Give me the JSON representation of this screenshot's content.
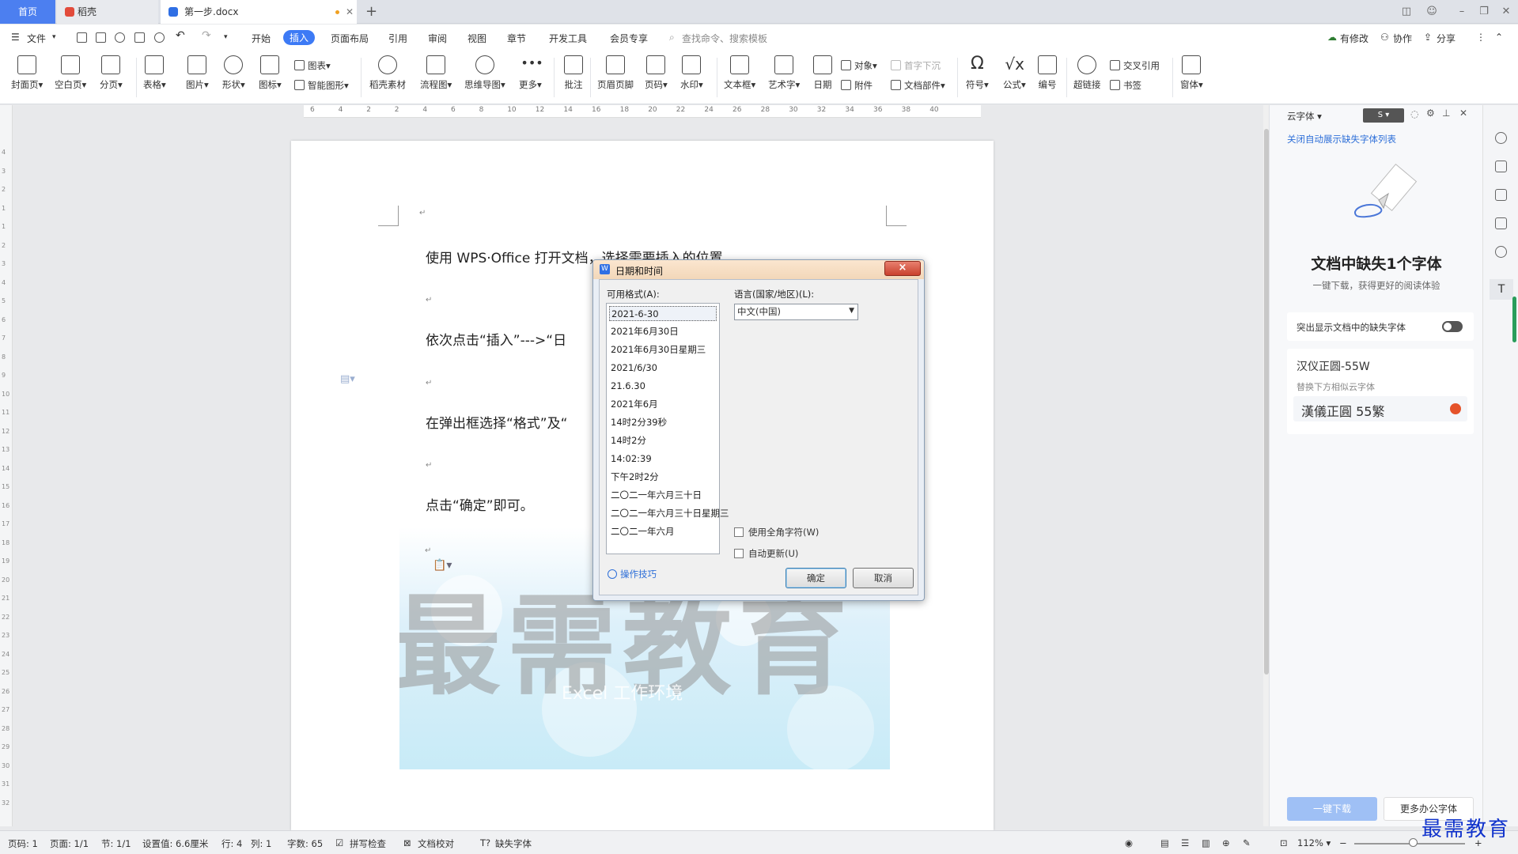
{
  "tabs": {
    "home": "首页",
    "daoke": "稻壳",
    "doc": "第一步.docx"
  },
  "menu": {
    "file": "文件",
    "items": [
      "开始",
      "插入",
      "页面布局",
      "引用",
      "审阅",
      "视图",
      "章节",
      "开发工具",
      "会员专享"
    ],
    "search": "查找命令、搜索模板",
    "right": [
      "有修改",
      "协作",
      "分享"
    ]
  },
  "ribbon": {
    "big": [
      "封面页",
      "空白页",
      "分页",
      "表格",
      "图片",
      "形状",
      "图标",
      "稻壳素材",
      "流程图",
      "思维导图",
      "更多",
      "批注",
      "页眉页脚",
      "页码",
      "水印",
      "文本框",
      "艺术字",
      "日期",
      "符号",
      "公式",
      "编号",
      "超链接",
      "窗体"
    ],
    "small": {
      "chart": "图表",
      "smart": "智能图形",
      "object": "对象",
      "dropcap": "首字下沉",
      "attach": "附件",
      "docpart": "文档部件",
      "crossref": "交叉引用",
      "bookmark": "书签"
    }
  },
  "ruler_numbers": [
    "6",
    "4",
    "2",
    "2",
    "4",
    "6",
    "8",
    "10",
    "12",
    "14",
    "16",
    "18",
    "20",
    "22",
    "24",
    "26",
    "28",
    "30",
    "32",
    "34",
    "36",
    "38",
    "40"
  ],
  "vruler_numbers": [
    "4",
    "3",
    "2",
    "1",
    "1",
    "2",
    "3",
    "4",
    "5",
    "6",
    "7",
    "8",
    "9",
    "10",
    "11",
    "12",
    "13",
    "14",
    "15",
    "16",
    "17",
    "18",
    "19",
    "20",
    "21",
    "22",
    "23",
    "24",
    "25",
    "26",
    "27",
    "28",
    "29",
    "30",
    "31",
    "32"
  ],
  "document": {
    "p1": "使用 WPS·Office 打开文档，选择需要插入的位置。",
    "p2": "依次点击“插入”--->“日",
    "p3": "在弹出框选择“格式”及“",
    "p4": "点击“确定”即可。",
    "para_mark": "↵",
    "watermark_big": "最需教育",
    "watermark_sub": "Excel 工作环境"
  },
  "dialog": {
    "title": "日期和时间",
    "formats_label": "可用格式(A):",
    "formats": [
      "2021-6-30",
      "2021年6月30日",
      "2021年6月30日星期三",
      "2021/6/30",
      "21.6.30",
      "2021年6月",
      "14时2分39秒",
      "14时2分",
      "14:02:39",
      "下午2时2分",
      "二〇二一年六月三十日",
      "二〇二一年六月三十日星期三",
      "二〇二一年六月"
    ],
    "language_label": "语言(国家/地区)(L):",
    "language_value": "中文(中国)",
    "fullwidth": "使用全角字符(W)",
    "autoupdate": "自动更新(U)",
    "tips": "操作技巧",
    "ok": "确定",
    "cancel": "取消",
    "close": "×"
  },
  "panel": {
    "header": "云字体",
    "link": "关闭自动展示缺失字体列表",
    "headline": "文档中缺失1个字体",
    "sub": "一键下载，获得更好的阅读体验",
    "highlight": "突出显示文档中的缺失字体",
    "font_name": "汉仪正圆-55W",
    "replace": "替换下方相似云字体",
    "cloud_font": "漢儀正圓 55繁",
    "download": "一键下载",
    "more": "更多办公字体"
  },
  "status": {
    "page": "页码: 1",
    "pages": "页面: 1/1",
    "section": "节: 1/1",
    "setting": "设置值: 6.6厘米",
    "row": "行: 4",
    "col": "列: 1",
    "words": "字数: 65",
    "spell": "拼写检查",
    "proof": "文档校对",
    "missing": "缺失字体",
    "zoom": "112%"
  },
  "corner_logo": "最需教育",
  "colors": {
    "accent": "#3d7af5",
    "dialog_close": "#c9412d",
    "link": "#2e6fd8"
  }
}
